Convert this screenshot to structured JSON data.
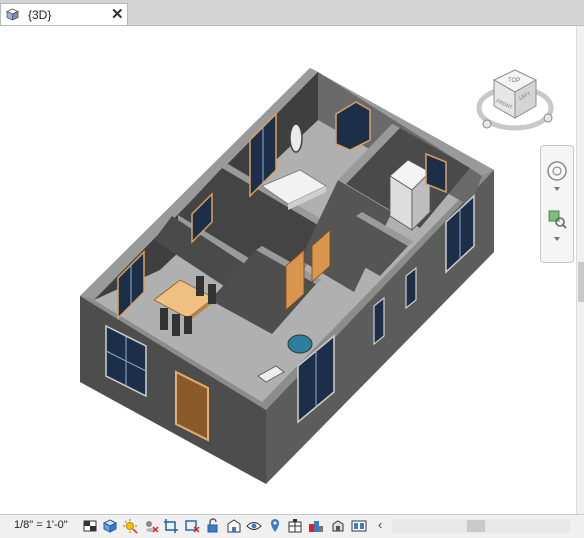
{
  "tab": {
    "title": "{3D}",
    "close": "✕",
    "icon": "3d-view-cube-icon"
  },
  "viewcube": {
    "top_label": "TOP",
    "front_label": "FRONT",
    "right_label": "LEFT"
  },
  "statusbar": {
    "scale": "1/8\" = 1'-0\"",
    "icons": [
      "detail-level-icon",
      "visual-style-icon",
      "sun-path-icon",
      "shadows-icon",
      "crop-view-icon",
      "show-crop-region-icon",
      "unlock-3d-view-icon",
      "temporary-hide-icon",
      "reveal-hidden-icon",
      "worksharing-display-icon",
      "analytical-model-icon",
      "highlight-displacement-icon",
      "temporary-view-properties-icon",
      "render-icon",
      "scroll-left-icon"
    ],
    "scroll_left": "‹"
  },
  "colors": {
    "wall_dark": "#555555",
    "wall_top": "#9a9a9a",
    "floor": "#a8a8a8",
    "wood": "#f0c080",
    "door": "#8b5a2b"
  }
}
